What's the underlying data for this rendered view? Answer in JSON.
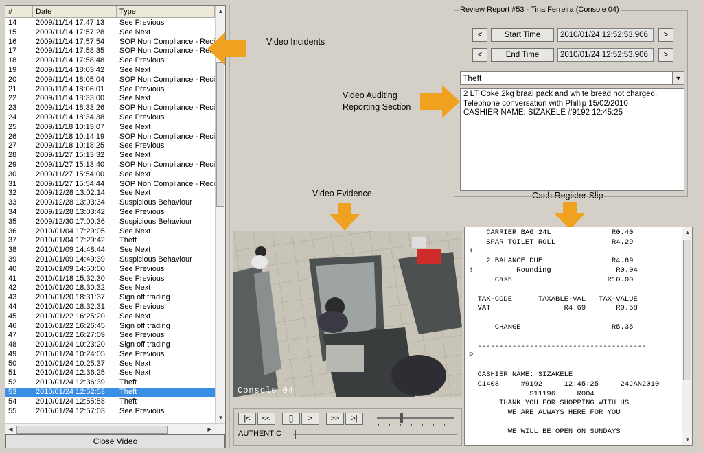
{
  "list": {
    "headers": [
      "#",
      "Date",
      "Type"
    ],
    "rows": [
      {
        "num": "14",
        "date": "2009/11/14 17:47:13",
        "type": "See Previous"
      },
      {
        "num": "15",
        "date": "2009/11/14 17:57:28",
        "type": "See Next"
      },
      {
        "num": "16",
        "date": "2009/11/14 17:57:54",
        "type": "SOP Non Compliance - Recie"
      },
      {
        "num": "17",
        "date": "2009/11/14 17:58:35",
        "type": "SOP Non Compliance - Recie"
      },
      {
        "num": "18",
        "date": "2009/11/14 17:58:48",
        "type": "See Previous"
      },
      {
        "num": "19",
        "date": "2009/11/14 18:03:42",
        "type": "See Next"
      },
      {
        "num": "20",
        "date": "2009/11/14 18:05:04",
        "type": "SOP Non Compliance - Recie"
      },
      {
        "num": "21",
        "date": "2009/11/14 18:06:01",
        "type": "See Previous"
      },
      {
        "num": "22",
        "date": "2009/11/14 18:33:00",
        "type": "See Next"
      },
      {
        "num": "23",
        "date": "2009/11/14 18:33:26",
        "type": "SOP Non Compliance - Recie"
      },
      {
        "num": "24",
        "date": "2009/11/14 18:34:38",
        "type": "See Previous"
      },
      {
        "num": "25",
        "date": "2009/11/18 10:13:07",
        "type": "See Next"
      },
      {
        "num": "26",
        "date": "2009/11/18 10:14:19",
        "type": "SOP Non Compliance - Recie"
      },
      {
        "num": "27",
        "date": "2009/11/18 10:18:25",
        "type": "See Previous"
      },
      {
        "num": "28",
        "date": "2009/11/27 15:13:32",
        "type": "See Next"
      },
      {
        "num": "29",
        "date": "2009/11/27 15:13:40",
        "type": "SOP Non Compliance - Recie"
      },
      {
        "num": "30",
        "date": "2009/11/27 15:54:00",
        "type": "See Next"
      },
      {
        "num": "31",
        "date": "2009/11/27 15:54:44",
        "type": "SOP Non Compliance - Recie"
      },
      {
        "num": "32",
        "date": "2009/12/28 13:02:14",
        "type": "See Next"
      },
      {
        "num": "33",
        "date": "2009/12/28 13:03:34",
        "type": "Suspicious Behaviour"
      },
      {
        "num": "34",
        "date": "2009/12/28 13:03:42",
        "type": "See Previous"
      },
      {
        "num": "35",
        "date": "2009/12/30 17:00:36",
        "type": "Suspicious Behaviour"
      },
      {
        "num": "36",
        "date": "2010/01/04 17:29:05",
        "type": "See Next"
      },
      {
        "num": "37",
        "date": "2010/01/04 17:29:42",
        "type": "Theft"
      },
      {
        "num": "38",
        "date": "2010/01/09 14:48:44",
        "type": "See Next"
      },
      {
        "num": "39",
        "date": "2010/01/09 14:49:39",
        "type": "Suspicious Behaviour"
      },
      {
        "num": "40",
        "date": "2010/01/09 14:50:00",
        "type": "See Previous"
      },
      {
        "num": "41",
        "date": "2010/01/18 15:32:30",
        "type": "See Previous"
      },
      {
        "num": "42",
        "date": "2010/01/20 18:30:32",
        "type": "See Next"
      },
      {
        "num": "43",
        "date": "2010/01/20 18:31:37",
        "type": "Sign off trading"
      },
      {
        "num": "44",
        "date": "2010/01/20 18:32:31",
        "type": "See Previous"
      },
      {
        "num": "45",
        "date": "2010/01/22 16:25:20",
        "type": "See Next"
      },
      {
        "num": "46",
        "date": "2010/01/22 16:26:45",
        "type": "Sign off trading"
      },
      {
        "num": "47",
        "date": "2010/01/22 16:27:09",
        "type": "See Previous"
      },
      {
        "num": "48",
        "date": "2010/01/24 10:23:20",
        "type": "Sign off trading"
      },
      {
        "num": "49",
        "date": "2010/01/24 10:24:05",
        "type": "See Previous"
      },
      {
        "num": "50",
        "date": "2010/01/24 10:25:37",
        "type": "See Next"
      },
      {
        "num": "51",
        "date": "2010/01/24 12:36:25",
        "type": "See Next"
      },
      {
        "num": "52",
        "date": "2010/01/24 12:36:39",
        "type": "Theft"
      },
      {
        "num": "53",
        "date": "2010/01/24 12:52:53",
        "type": "Theft",
        "selected": true
      },
      {
        "num": "54",
        "date": "2010/01/24 12:55:58",
        "type": "Theft"
      },
      {
        "num": "55",
        "date": "2010/01/24 12:57:03",
        "type": "See Previous"
      }
    ],
    "close_label": "Close Video"
  },
  "annotations": {
    "incidents": "Video Incidents",
    "auditing": "Video Auditing\nReporting Section",
    "evidence": "Video Evidence",
    "slip": "Cash Register Slip"
  },
  "review": {
    "title": "Review Report #53 - Tina Ferreira (Console 04)",
    "prev_symbol": "<",
    "next_symbol": ">",
    "start_label": "Start Time",
    "start_value": "2010/01/24 12:52:53.906",
    "end_label": "End Time",
    "end_value": "2010/01/24 12:52:53.906",
    "category": "Theft",
    "notes": "2 LT Coke,2kg braai pack and white bread not charged.\nTelephone conversation with Phillip 15/02/2010\nCASHIER NAME: SIZAKELE     #9192     12:45:25"
  },
  "video": {
    "overlay": "Console 04"
  },
  "controls": {
    "buttons": [
      "|<",
      "<<",
      "[]",
      ">",
      ">>",
      ">|"
    ],
    "mode_label": "AUTHENTIC"
  },
  "slip": {
    "text": "    CARRIER BAG 24L              R0.40\n    SPAR TOILET ROLL             R4.29\n!\n    2 BALANCE DUE                R4.69\n!          Rounding               R0.04\n      Cash                      R10.00\n\n  TAX-CODE      TAXABLE-VAL   TAX-VALUE\n  VAT                 R4.69       R0.58\n\n      CHANGE                     R5.35\n\n  ---------------------------------------\nP\n\n  CASHIER NAME: SIZAKELE\n  C1408     #9192     12:45:25     24JAN2010\n              S11196     R004\n       THANK YOU FOR SHOPPING WITH US\n         WE ARE ALWAYS HERE FOR YOU\n\n         WE WILL BE OPEN ON SUNDAYS"
  },
  "colors": {
    "arrow": "#f0a11f",
    "selection": "#3a8ee6"
  }
}
